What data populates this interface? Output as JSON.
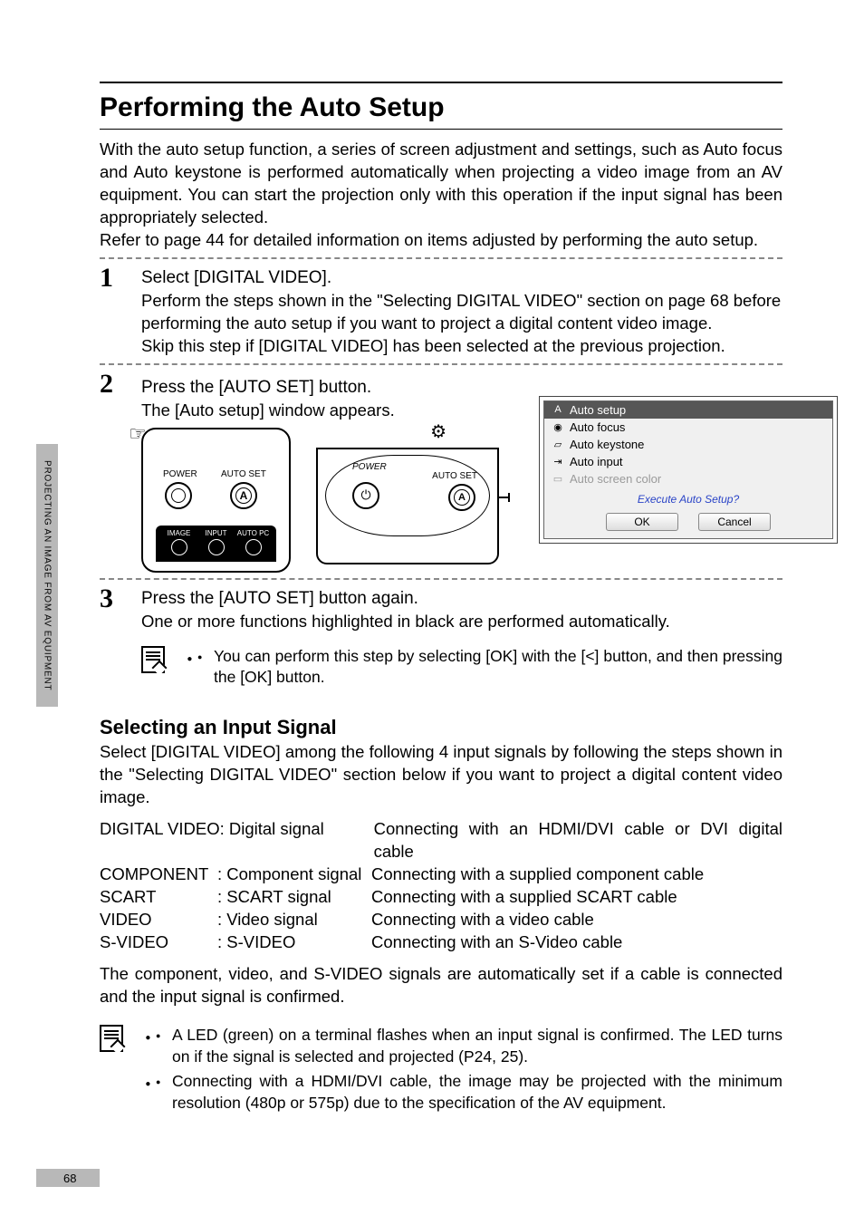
{
  "side_tab": "PROJECTING AN IMAGE FROM AV EQUIPMENT",
  "title": "Performing the Auto Setup",
  "intro": "With the auto setup function, a series of screen adjustment and settings, such as Auto focus and Auto keystone is performed automatically when projecting a video image from an AV equipment. You can start the projection only with this operation if the input signal has been appropriately selected.",
  "intro_ref": "Refer to page 44 for detailed information on items adjusted by performing the auto setup.",
  "steps": {
    "s1": {
      "num": "1",
      "title": "Select [DIGITAL VIDEO].",
      "body1": "Perform the steps shown in the \"Selecting DIGITAL VIDEO\" section on page 68 before performing the auto setup if you want to project a digital content video image.",
      "body2": "Skip this step if [DIGITAL VIDEO] has been selected at the previous projection."
    },
    "s2": {
      "num": "2",
      "title": "Press the [AUTO SET] button.",
      "body": "The [Auto setup] window appears."
    },
    "s3": {
      "num": "3",
      "title": "Press the [AUTO SET] button again.",
      "body": "One or more functions highlighted in black are performed automatically."
    }
  },
  "remote": {
    "power": "POWER",
    "autoset": "AUTO SET",
    "bottom": {
      "image": "IMAGE",
      "input": "INPUT",
      "autopc": "AUTO PC"
    },
    "a_glyph": "A"
  },
  "toppanel": {
    "power": "POWER",
    "autoset": "AUTO SET",
    "a_glyph": "A"
  },
  "dialog": {
    "items": [
      {
        "icon": "A",
        "label": "Auto setup",
        "sel": true,
        "dim": false
      },
      {
        "icon": "◉",
        "label": "Auto focus",
        "sel": false,
        "dim": false
      },
      {
        "icon": "▱",
        "label": "Auto keystone",
        "sel": false,
        "dim": false
      },
      {
        "icon": "⇥",
        "label": "Auto input",
        "sel": false,
        "dim": false
      },
      {
        "icon": "▭",
        "label": "Auto screen color",
        "sel": false,
        "dim": true
      }
    ],
    "prompt": "Execute Auto Setup?",
    "ok": "OK",
    "cancel": "Cancel"
  },
  "note1": "You can perform this step by selecting [OK] with the [<] button, and then pressing the [OK] button.",
  "subheading": "Selecting an Input Signal",
  "sub_intro": "Select [DIGITAL VIDEO] among the following 4 input signals by following the steps shown in the \"Selecting DIGITAL VIDEO\" section below if you want to project a digital content video image.",
  "signals": [
    {
      "name": "DIGITAL VIDEO",
      "type": ": Digital signal",
      "desc": "Connecting with an HDMI/DVI cable or DVI digital cable"
    },
    {
      "name": "COMPONENT",
      "type": ": Component signal",
      "desc": "Connecting with a supplied component cable"
    },
    {
      "name": "SCART",
      "type": ": SCART signal",
      "desc": "Connecting with a supplied SCART cable"
    },
    {
      "name": "VIDEO",
      "type": ": Video signal",
      "desc": "Connecting with a video cable"
    },
    {
      "name": "S-VIDEO",
      "type": ": S-VIDEO",
      "desc": "Connecting with an S-Video cable"
    }
  ],
  "after_table": "The component, video, and S-VIDEO signals are automatically set if a cable is connected and the input signal is confirmed.",
  "notes2": [
    "A LED (green) on a terminal flashes when an input signal is confirmed. The LED turns on if the signal is selected and projected (P24, 25).",
    "Connecting with a HDMI/DVI cable, the image may be projected with the minimum resolution (480p or 575p) due to the specification of the AV equipment."
  ],
  "page_number": "68"
}
